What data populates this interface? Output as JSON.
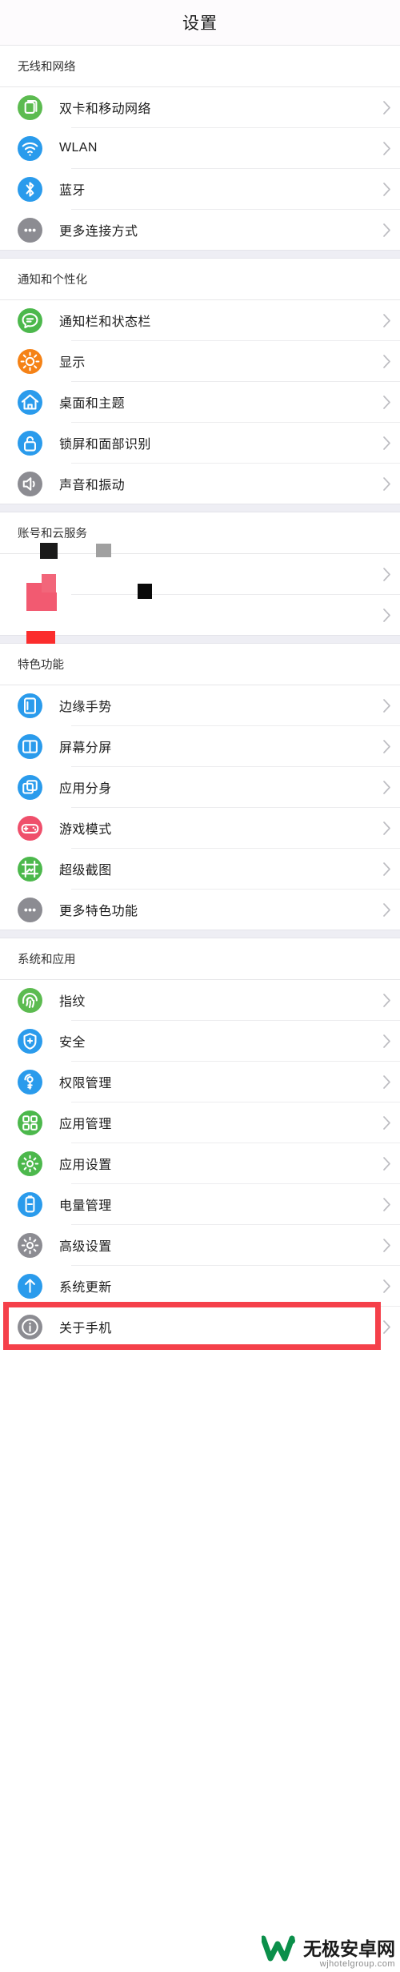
{
  "header": {
    "title": "设置"
  },
  "colors": {
    "accent_red": "#f5404a",
    "group_bg": "#eeeef4",
    "row_bg": "#ffffff",
    "title_bg": "#fdfbfd",
    "icon_green": "#5cbb50",
    "icon_blue": "#2a9bec",
    "icon_gray": "#8c8c92",
    "icon_orange": "#f58216",
    "icon_pink": "#ef4f6b",
    "chevron": "#bdbdc2"
  },
  "sections": [
    {
      "title": "无线和网络",
      "items": [
        {
          "label": "双卡和移动网络",
          "icon": "sim-card-icon",
          "icon_color": "#5cbb50"
        },
        {
          "label": "WLAN",
          "icon": "wifi-icon",
          "icon_color": "#2a9bec"
        },
        {
          "label": "蓝牙",
          "icon": "bluetooth-icon",
          "icon_color": "#2a9bec"
        },
        {
          "label": "更多连接方式",
          "icon": "more-dots-icon",
          "icon_color": "#8c8c92"
        }
      ]
    },
    {
      "title": "通知和个性化",
      "items": [
        {
          "label": "通知栏和状态栏",
          "icon": "chat-bubble-icon",
          "icon_color": "#4cb84c"
        },
        {
          "label": "显示",
          "icon": "brightness-icon",
          "icon_color": "#f58216"
        },
        {
          "label": "桌面和主题",
          "icon": "home-icon",
          "icon_color": "#2a9bec"
        },
        {
          "label": "锁屏和面部识别",
          "icon": "lock-icon",
          "icon_color": "#2a9bec"
        },
        {
          "label": "声音和振动",
          "icon": "speaker-icon",
          "icon_color": "#8c8c92"
        }
      ]
    },
    {
      "title": "账号和云服务",
      "glitched": true,
      "items": [
        {
          "label": "",
          "icon": "glitch-icon",
          "icon_color": "#ffffff"
        },
        {
          "label": "",
          "icon": "glitch-icon",
          "icon_color": "#ffffff"
        }
      ]
    },
    {
      "title": "特色功能",
      "items": [
        {
          "label": "边缘手势",
          "icon": "edge-gesture-icon",
          "icon_color": "#2a9bec"
        },
        {
          "label": "屏幕分屏",
          "icon": "split-screen-icon",
          "icon_color": "#2a9bec"
        },
        {
          "label": "应用分身",
          "icon": "app-clone-icon",
          "icon_color": "#2a9bec"
        },
        {
          "label": "游戏模式",
          "icon": "gamepad-icon",
          "icon_color": "#ef4f6b"
        },
        {
          "label": "超级截图",
          "icon": "screenshot-icon",
          "icon_color": "#4cb84c"
        },
        {
          "label": "更多特色功能",
          "icon": "more-dots-icon",
          "icon_color": "#8c8c92"
        }
      ]
    },
    {
      "title": "系统和应用",
      "items": [
        {
          "label": "指纹",
          "icon": "fingerprint-icon",
          "icon_color": "#5cbb50"
        },
        {
          "label": "安全",
          "icon": "shield-icon",
          "icon_color": "#2a9bec"
        },
        {
          "label": "权限管理",
          "icon": "key-icon",
          "icon_color": "#2a9bec"
        },
        {
          "label": "应用管理",
          "icon": "apps-grid-icon",
          "icon_color": "#4cb84c"
        },
        {
          "label": "应用设置",
          "icon": "gear-icon",
          "icon_color": "#4cb84c"
        },
        {
          "label": "电量管理",
          "icon": "battery-icon",
          "icon_color": "#2a9bec"
        },
        {
          "label": "高级设置",
          "icon": "gear-icon",
          "icon_color": "#8c8c92"
        },
        {
          "label": "系统更新",
          "icon": "update-arrow-icon",
          "icon_color": "#2a9bec"
        },
        {
          "label": "关于手机",
          "icon": "info-icon",
          "icon_color": "#8c8c92",
          "highlighted": true
        }
      ]
    }
  ],
  "watermark": {
    "main": "无极安卓网",
    "sub": "wjhotelgroup.com"
  }
}
